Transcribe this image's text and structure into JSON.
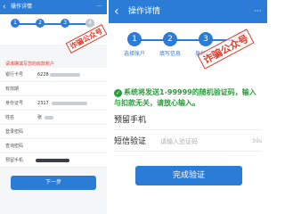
{
  "left": {
    "header": {
      "back_icon": "‹",
      "title": "操作详情",
      "more_icon": "···"
    },
    "steps": [
      {
        "num": "1",
        "label": ""
      },
      {
        "num": "2",
        "label": ""
      },
      {
        "num": "3",
        "label": ""
      },
      {
        "num": "4",
        "label": ""
      }
    ],
    "stamp": "诈骗公众号",
    "notice": "请准确填写您的收款账户",
    "form": [
      {
        "label": "银行卡号",
        "value": "6228"
      },
      {
        "label": "有效期",
        "value": ""
      },
      {
        "label": "身份证号",
        "value": "2317"
      },
      {
        "label": "姓名",
        "value": "张"
      },
      {
        "label": "登录密码",
        "value": ""
      },
      {
        "label": "查询密码",
        "value": ""
      },
      {
        "label": "预留手机",
        "value": ""
      }
    ],
    "next_button": "下一步"
  },
  "right": {
    "header": {
      "back_icon": "‹",
      "title": "操作详情",
      "more_icon": "···"
    },
    "steps": [
      {
        "num": "1",
        "label": "选择账户"
      },
      {
        "num": "2",
        "label": "填写信息"
      },
      {
        "num": "3",
        "label": "身份验证"
      },
      {
        "num": "4",
        "label": ""
      }
    ],
    "stamp": "诈骗公众号",
    "sms_notice": "系统将发送1-99999的随机验证码，输入与扣款无关，请放心输入。",
    "phone_label": "预留手机",
    "sms_label": "短信验证",
    "sms_placeholder": "请输入验证码",
    "sms_timer": "59s",
    "submit_button": "完成验证"
  },
  "colors": {
    "accent": "#2b7cd6",
    "warning": "#e23b2a",
    "success": "#2a9d3a"
  }
}
